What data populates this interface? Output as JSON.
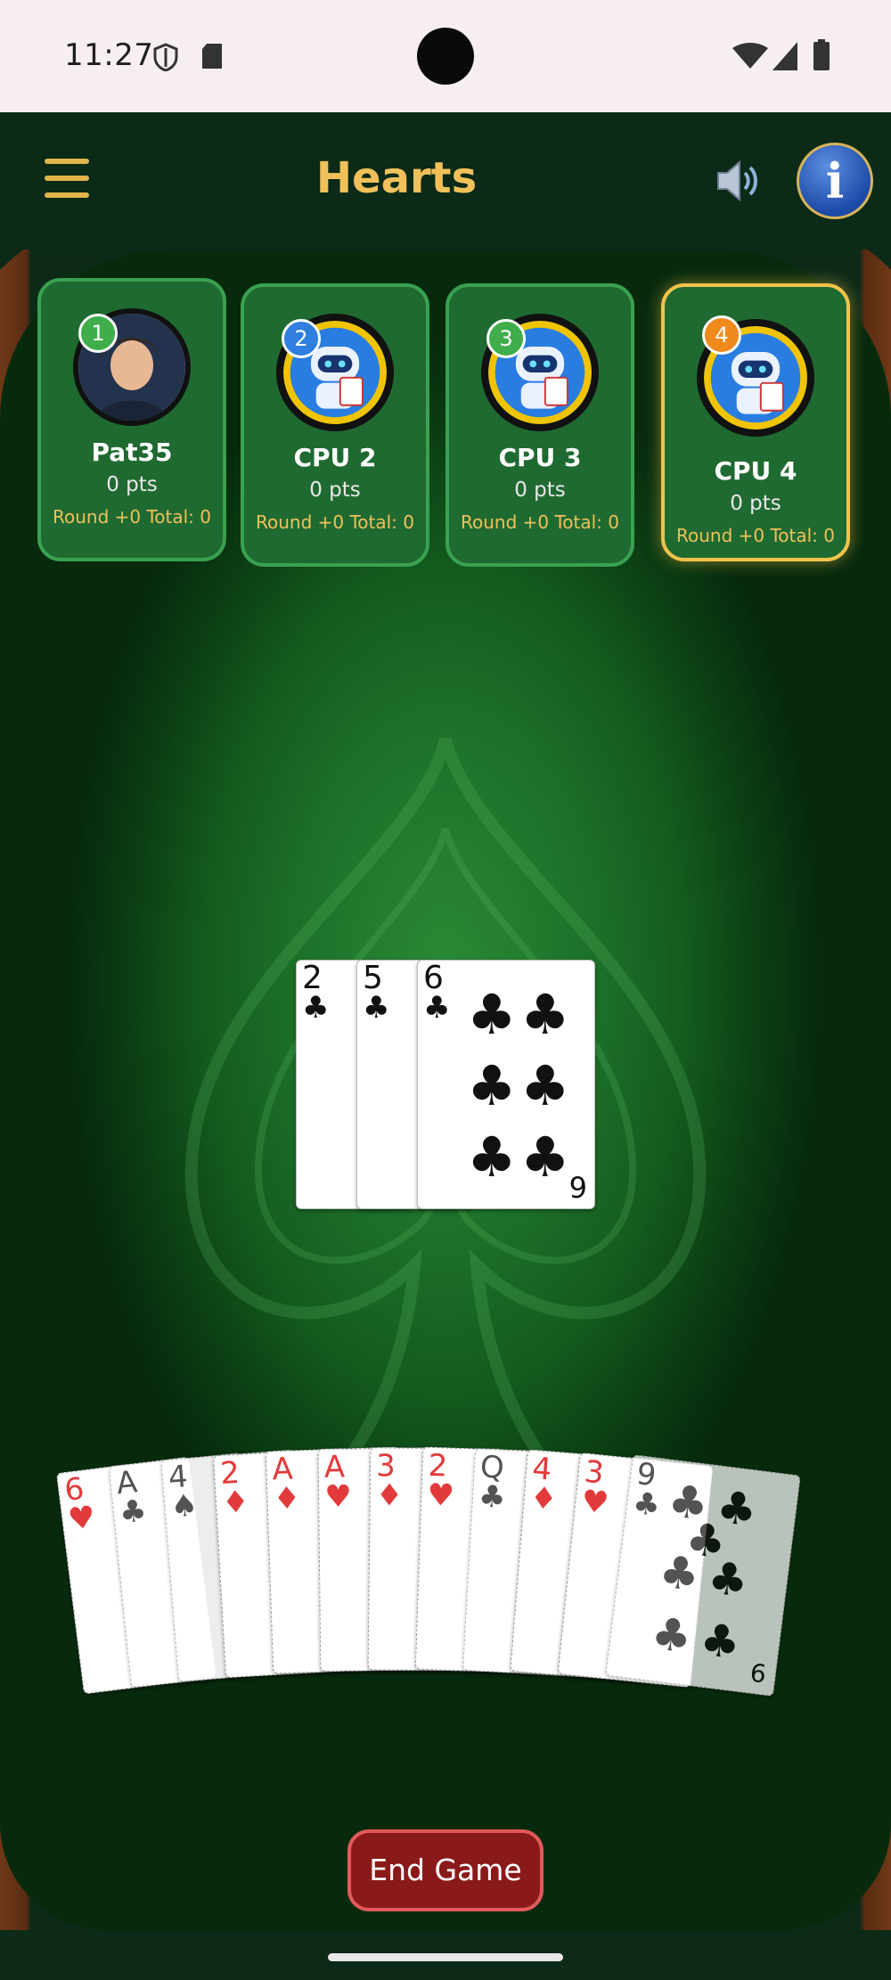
{
  "status_bar": {
    "time": "11:27"
  },
  "header": {
    "menu_icon": "menu-icon",
    "title": "Hearts",
    "sound_icon": "speaker-icon",
    "info_label": "i"
  },
  "players": [
    {
      "seat": "1",
      "name": "Pat35",
      "pts": "0 pts",
      "round_total": "Round +0  Total: 0",
      "badge_color": "#3fae4a",
      "type": "human"
    },
    {
      "seat": "2",
      "name": "CPU 2",
      "pts": "0 pts",
      "round_total": "Round +0  Total: 0",
      "badge_color": "#2e7fe0",
      "type": "cpu"
    },
    {
      "seat": "3",
      "name": "CPU 3",
      "pts": "0 pts",
      "round_total": "Round +0  Total: 0",
      "badge_color": "#3fae4a",
      "type": "cpu"
    },
    {
      "seat": "4",
      "name": "CPU 4",
      "pts": "0 pts",
      "round_total": "Round +0  Total: 0",
      "badge_color": "#f08a1c",
      "type": "cpu",
      "active": true
    }
  ],
  "trick": [
    {
      "rank": "2",
      "suit": "♣",
      "color": "black"
    },
    {
      "rank": "5",
      "suit": "♣",
      "color": "black"
    },
    {
      "rank": "6",
      "suit": "♣",
      "color": "black",
      "bottom_rank": "9"
    }
  ],
  "hand": [
    {
      "rank": "6",
      "suit": "♥",
      "color": "red"
    },
    {
      "rank": "A",
      "suit": "♣",
      "color": "black"
    },
    {
      "rank": "4",
      "suit": "♠",
      "color": "black"
    },
    {
      "rank": "2",
      "suit": "♦",
      "color": "red"
    },
    {
      "rank": "A",
      "suit": "♦",
      "color": "red"
    },
    {
      "rank": "A",
      "suit": "♥",
      "color": "red"
    },
    {
      "rank": "3",
      "suit": "♦",
      "color": "red"
    },
    {
      "rank": "2",
      "suit": "♥",
      "color": "red"
    },
    {
      "rank": "Q",
      "suit": "♣",
      "color": "black"
    },
    {
      "rank": "4",
      "suit": "♦",
      "color": "red"
    },
    {
      "rank": "3",
      "suit": "♥",
      "color": "red"
    },
    {
      "rank": "9",
      "suit": "♣",
      "color": "black",
      "bottom_rank": "6"
    }
  ],
  "actions": {
    "end_game": "End Game"
  }
}
